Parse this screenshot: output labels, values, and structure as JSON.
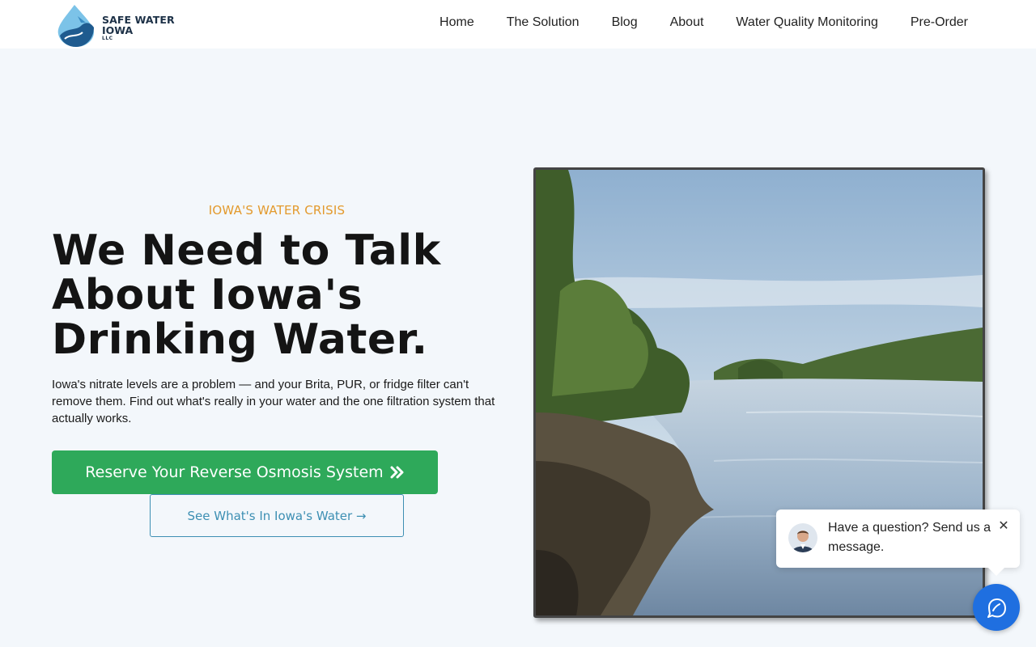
{
  "brand": {
    "line1": "SAFE WATER",
    "line2": "IOWA",
    "line3": "LLC"
  },
  "nav": {
    "items": [
      {
        "label": "Home"
      },
      {
        "label": "The Solution"
      },
      {
        "label": "Blog"
      },
      {
        "label": "About"
      },
      {
        "label": "Water Quality Monitoring"
      },
      {
        "label": "Pre-Order"
      }
    ]
  },
  "hero": {
    "eyebrow": "IOWA'S WATER CRISIS",
    "headline": "We Need to Talk About Iowa's Drinking Water.",
    "description": "Iowa's nitrate levels are a problem — and your Brita, PUR, or fridge filter can't remove them. Find out what's really in your water and the one filtration system that actually works.",
    "primary_button": "Reserve Your Reverse Osmosis System",
    "primary_button_icon": "double-chevron-right-icon",
    "secondary_button": "See What's In Iowa's Water →"
  },
  "chat": {
    "message": "Have a question? Send us a message.",
    "close_symbol": "✕"
  },
  "colors": {
    "accent_orange": "#e39a2d",
    "button_green": "#2ea95a",
    "secondary_blue": "#3d8fb3",
    "chat_blue": "#1f6fe0",
    "page_bg": "#f3f7fb"
  }
}
